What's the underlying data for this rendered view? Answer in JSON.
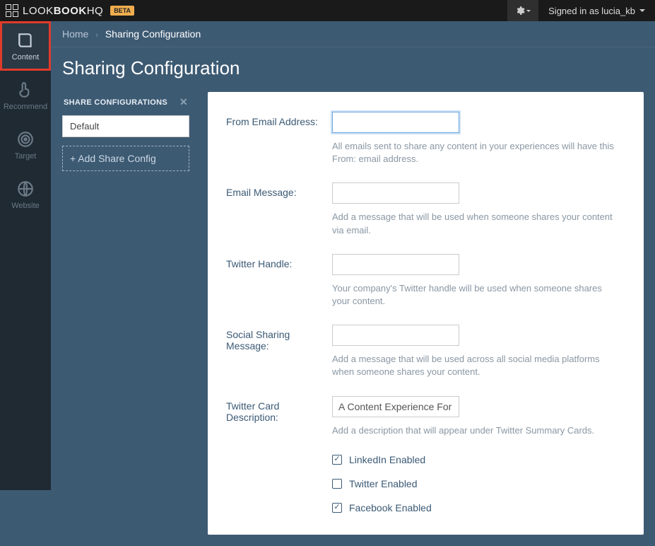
{
  "topbar": {
    "brand_prefix": "LOOK",
    "brand_mid": "BOOK",
    "brand_suffix": "HQ",
    "beta": "BETA",
    "signed_in": "Signed in as lucia_kb"
  },
  "nav": {
    "items": [
      {
        "label": "Content"
      },
      {
        "label": "Recommend"
      },
      {
        "label": "Target"
      },
      {
        "label": "Website"
      }
    ]
  },
  "breadcrumb": {
    "home": "Home",
    "current": "Sharing Configuration"
  },
  "page": {
    "title": "Sharing Configuration"
  },
  "panel": {
    "header": "SHARE CONFIGURATIONS",
    "items": [
      {
        "label": "Default"
      }
    ],
    "add_label": "+ Add Share Config"
  },
  "form": {
    "from_email": {
      "label": "From Email Address:",
      "value": "",
      "help": "All emails sent to share any content in your experiences will have this From: email address."
    },
    "email_msg": {
      "label": "Email Message:",
      "value": "",
      "help": "Add a message that will be used when someone shares your content via email."
    },
    "twitter_handle": {
      "label": "Twitter Handle:",
      "value": "",
      "help": "Your company's Twitter handle will be used when someone shares your content."
    },
    "social_msg": {
      "label": "Social Sharing Message:",
      "value": "",
      "help": "Add a message that will be used across all social media platforms when someone shares your content."
    },
    "twitter_card": {
      "label": "Twitter Card Description:",
      "value": "A Content Experience For Y",
      "help": "Add a description that will appear under Twitter Summary Cards."
    },
    "checks": {
      "linkedin": {
        "label": "LinkedIn Enabled",
        "checked": true
      },
      "twitter": {
        "label": "Twitter Enabled",
        "checked": false
      },
      "facebook": {
        "label": "Facebook Enabled",
        "checked": true
      }
    }
  }
}
